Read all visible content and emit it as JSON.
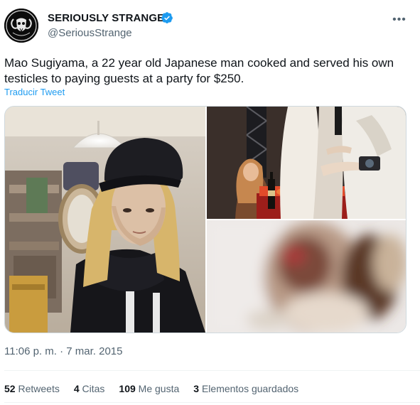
{
  "author": {
    "name": "SERIOUSLY STRANGE",
    "handle": "@SeriousStrange",
    "verified_color": "#1d9bf0"
  },
  "more_icon": "more-horizontal-icon",
  "tweet": {
    "text": "Mao Sugiyama, a 22 year old Japanese man cooked and served his own testicles to paying guests at a party for $250.",
    "translate_label": "Traducir Tweet"
  },
  "meta": {
    "time_date": "11:06 p. m. · 7 mar. 2015"
  },
  "stats": {
    "retweets_count": "52",
    "retweets_label": "Retweets",
    "quotes_count": "4",
    "quotes_label": "Citas",
    "likes_count": "109",
    "likes_label": "Me gusta",
    "bookmarks_count": "3",
    "bookmarks_label": "Elementos guardados"
  },
  "colors": {
    "link": "#1d9bf0",
    "secondary_text": "#536471",
    "primary_text": "#0f1419"
  }
}
